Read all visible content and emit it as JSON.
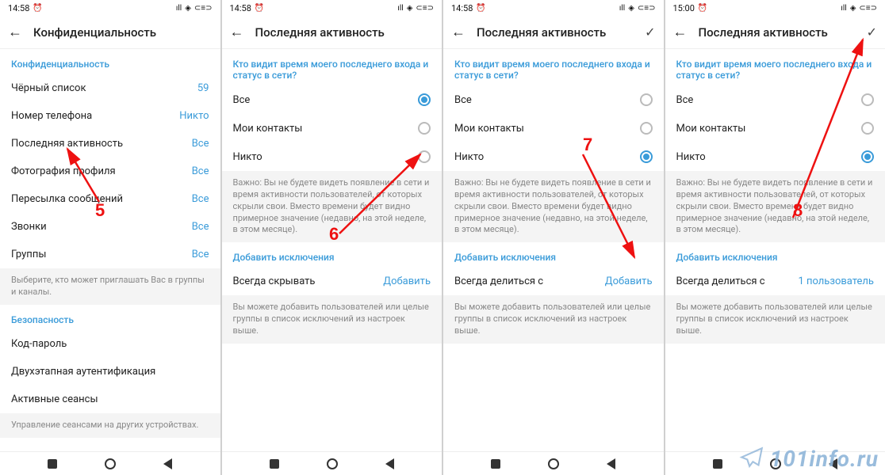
{
  "status": {
    "time1": "14:58",
    "time2": "15:00",
    "alarm": "⏰",
    "signal": "ıll",
    "wifi": "⋮",
    "battery": "⊂≡⊃"
  },
  "screen1": {
    "title": "Конфиденциальность",
    "section1": "Конфиденциальность",
    "rows": [
      {
        "label": "Чёрный список",
        "value": "59"
      },
      {
        "label": "Номер телефона",
        "value": "Никто"
      },
      {
        "label": "Последняя активность",
        "value": "Все"
      },
      {
        "label": "Фотография профиля",
        "value": "Все"
      },
      {
        "label": "Пересылка сообщений",
        "value": "Все"
      },
      {
        "label": "Звонки",
        "value": "Все"
      },
      {
        "label": "Группы",
        "value": "Все"
      }
    ],
    "info1": "Выберите, кто может приглашать Вас в группы и каналы.",
    "section2": "Безопасность",
    "rows2": [
      {
        "label": "Код-пароль"
      },
      {
        "label": "Двухэтапная аутентификация"
      },
      {
        "label": "Активные сеансы"
      }
    ],
    "info2": "Управление сеансами на других устройствах."
  },
  "lastseen": {
    "title": "Последняя активность",
    "question": "Кто видит время моего последнего входа и статус в сети?",
    "opt1": "Все",
    "opt2": "Мои контакты",
    "opt3": "Никто",
    "important": "Важно: Вы не будете видеть появление в сети и время активности пользователей, от которых скрыли свои. Вместо времени будет видно примерное значение (недавно, на этой неделе, в этом месяце).",
    "add_header": "Добавить исключения",
    "hide_label": "Всегда скрывать",
    "share_label": "Всегда делиться с",
    "add_action": "Добавить",
    "one_user": "1 пользователь",
    "exceptions_info": "Вы можете добавить пользователей или целые группы в список исключений из настроек выше."
  },
  "annotations": {
    "n5": "5",
    "n6": "6",
    "n7": "7",
    "n8": "8"
  },
  "watermark": "101info.ru"
}
